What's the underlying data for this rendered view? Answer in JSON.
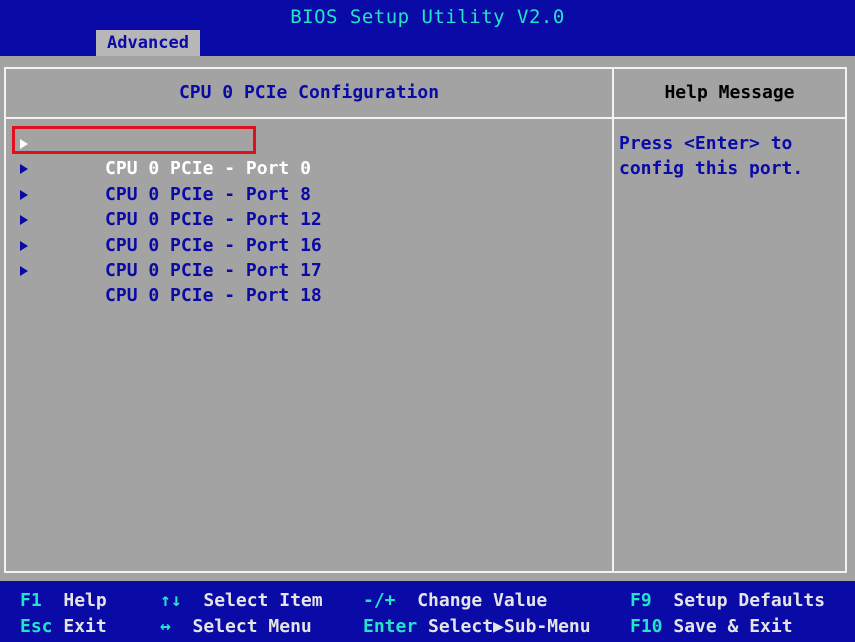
{
  "header": {
    "title": "BIOS Setup Utility V2.0",
    "tab": "Advanced"
  },
  "main": {
    "title": "CPU 0 PCIe Configuration",
    "items": [
      {
        "label": "CPU 0 PCIe - Port 0",
        "selected": true
      },
      {
        "label": "CPU 0 PCIe - Port 8"
      },
      {
        "label": "CPU 0 PCIe - Port 12"
      },
      {
        "label": "CPU 0 PCIe - Port 16"
      },
      {
        "label": "CPU 0 PCIe - Port 17"
      },
      {
        "label": "CPU 0 PCIe - Port 18"
      }
    ]
  },
  "help": {
    "title": "Help Message",
    "text": "Press <Enter> to\nconfig this port."
  },
  "footer": {
    "f1": {
      "key": "F1",
      "label": "Help"
    },
    "esc": {
      "key": "Esc",
      "label": "Exit"
    },
    "updown": {
      "key": "↑↓",
      "label": "Select Item"
    },
    "leftright": {
      "key": "↔",
      "label": "Select Menu"
    },
    "minusplus": {
      "key": "-/+",
      "label": "Change Value"
    },
    "enter": {
      "key": "Enter",
      "label": "Select▶Sub-Menu"
    },
    "f9": {
      "key": "F9",
      "label": "Setup Defaults"
    },
    "f10": {
      "key": "F10",
      "label": "Save & Exit"
    }
  },
  "colors": {
    "background": "#0a0aa6",
    "panel": "#a3a3a3",
    "key": "#22e4c8",
    "highlight": "#e0101c"
  }
}
